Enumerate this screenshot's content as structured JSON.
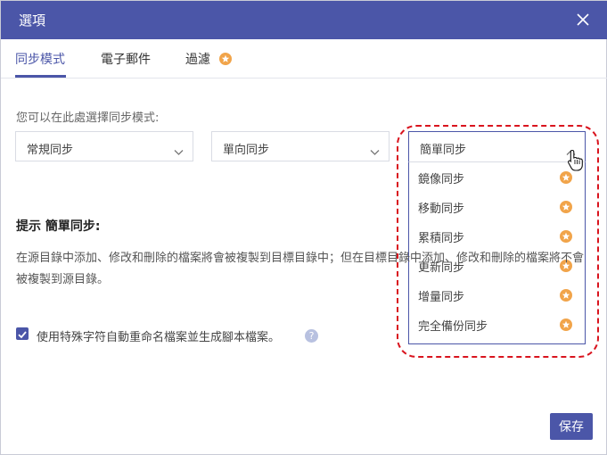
{
  "window": {
    "title": "選項",
    "close_icon": "close-icon"
  },
  "tabs": [
    {
      "label": "同步模式",
      "active": true
    },
    {
      "label": "電子郵件",
      "active": false
    },
    {
      "label": "過濾",
      "active": false,
      "badge": "star-icon"
    }
  ],
  "main": {
    "description": "您可以在此處選擇同步模式:",
    "selects": [
      {
        "value": "常規同步",
        "icon": "chevron-down-icon"
      },
      {
        "value": "單向同步",
        "icon": "chevron-down-icon"
      },
      {
        "value": "簡單同步",
        "icon": "chevron-up-icon",
        "open": true
      }
    ],
    "dropdown_options": [
      {
        "label": "鏡像同步",
        "badge": "star-icon"
      },
      {
        "label": "移動同步",
        "badge": "star-icon"
      },
      {
        "label": "累積同步",
        "badge": "star-icon"
      },
      {
        "label": "更新同步",
        "badge": "star-icon"
      },
      {
        "label": "增量同步",
        "badge": "star-icon"
      },
      {
        "label": "完全備份同步",
        "badge": "star-icon"
      }
    ],
    "hint_title": "提示 簡單同步:",
    "hint_body": "在源目錄中添加、修改和刪除的檔案將會被複製到目標目錄中；但在目標目錄中添加、修改和刪除的檔案將不會被複製到源目錄。",
    "checkbox": {
      "checked": true,
      "label": "使用特殊字符自動重命名檔案並生成腳本檔案。"
    },
    "help_icon": "?"
  },
  "footer": {
    "save_label": "保存"
  },
  "colors": {
    "accent": "#4b56a8",
    "star": "#f1a44a",
    "highlight": "#d9141e"
  }
}
